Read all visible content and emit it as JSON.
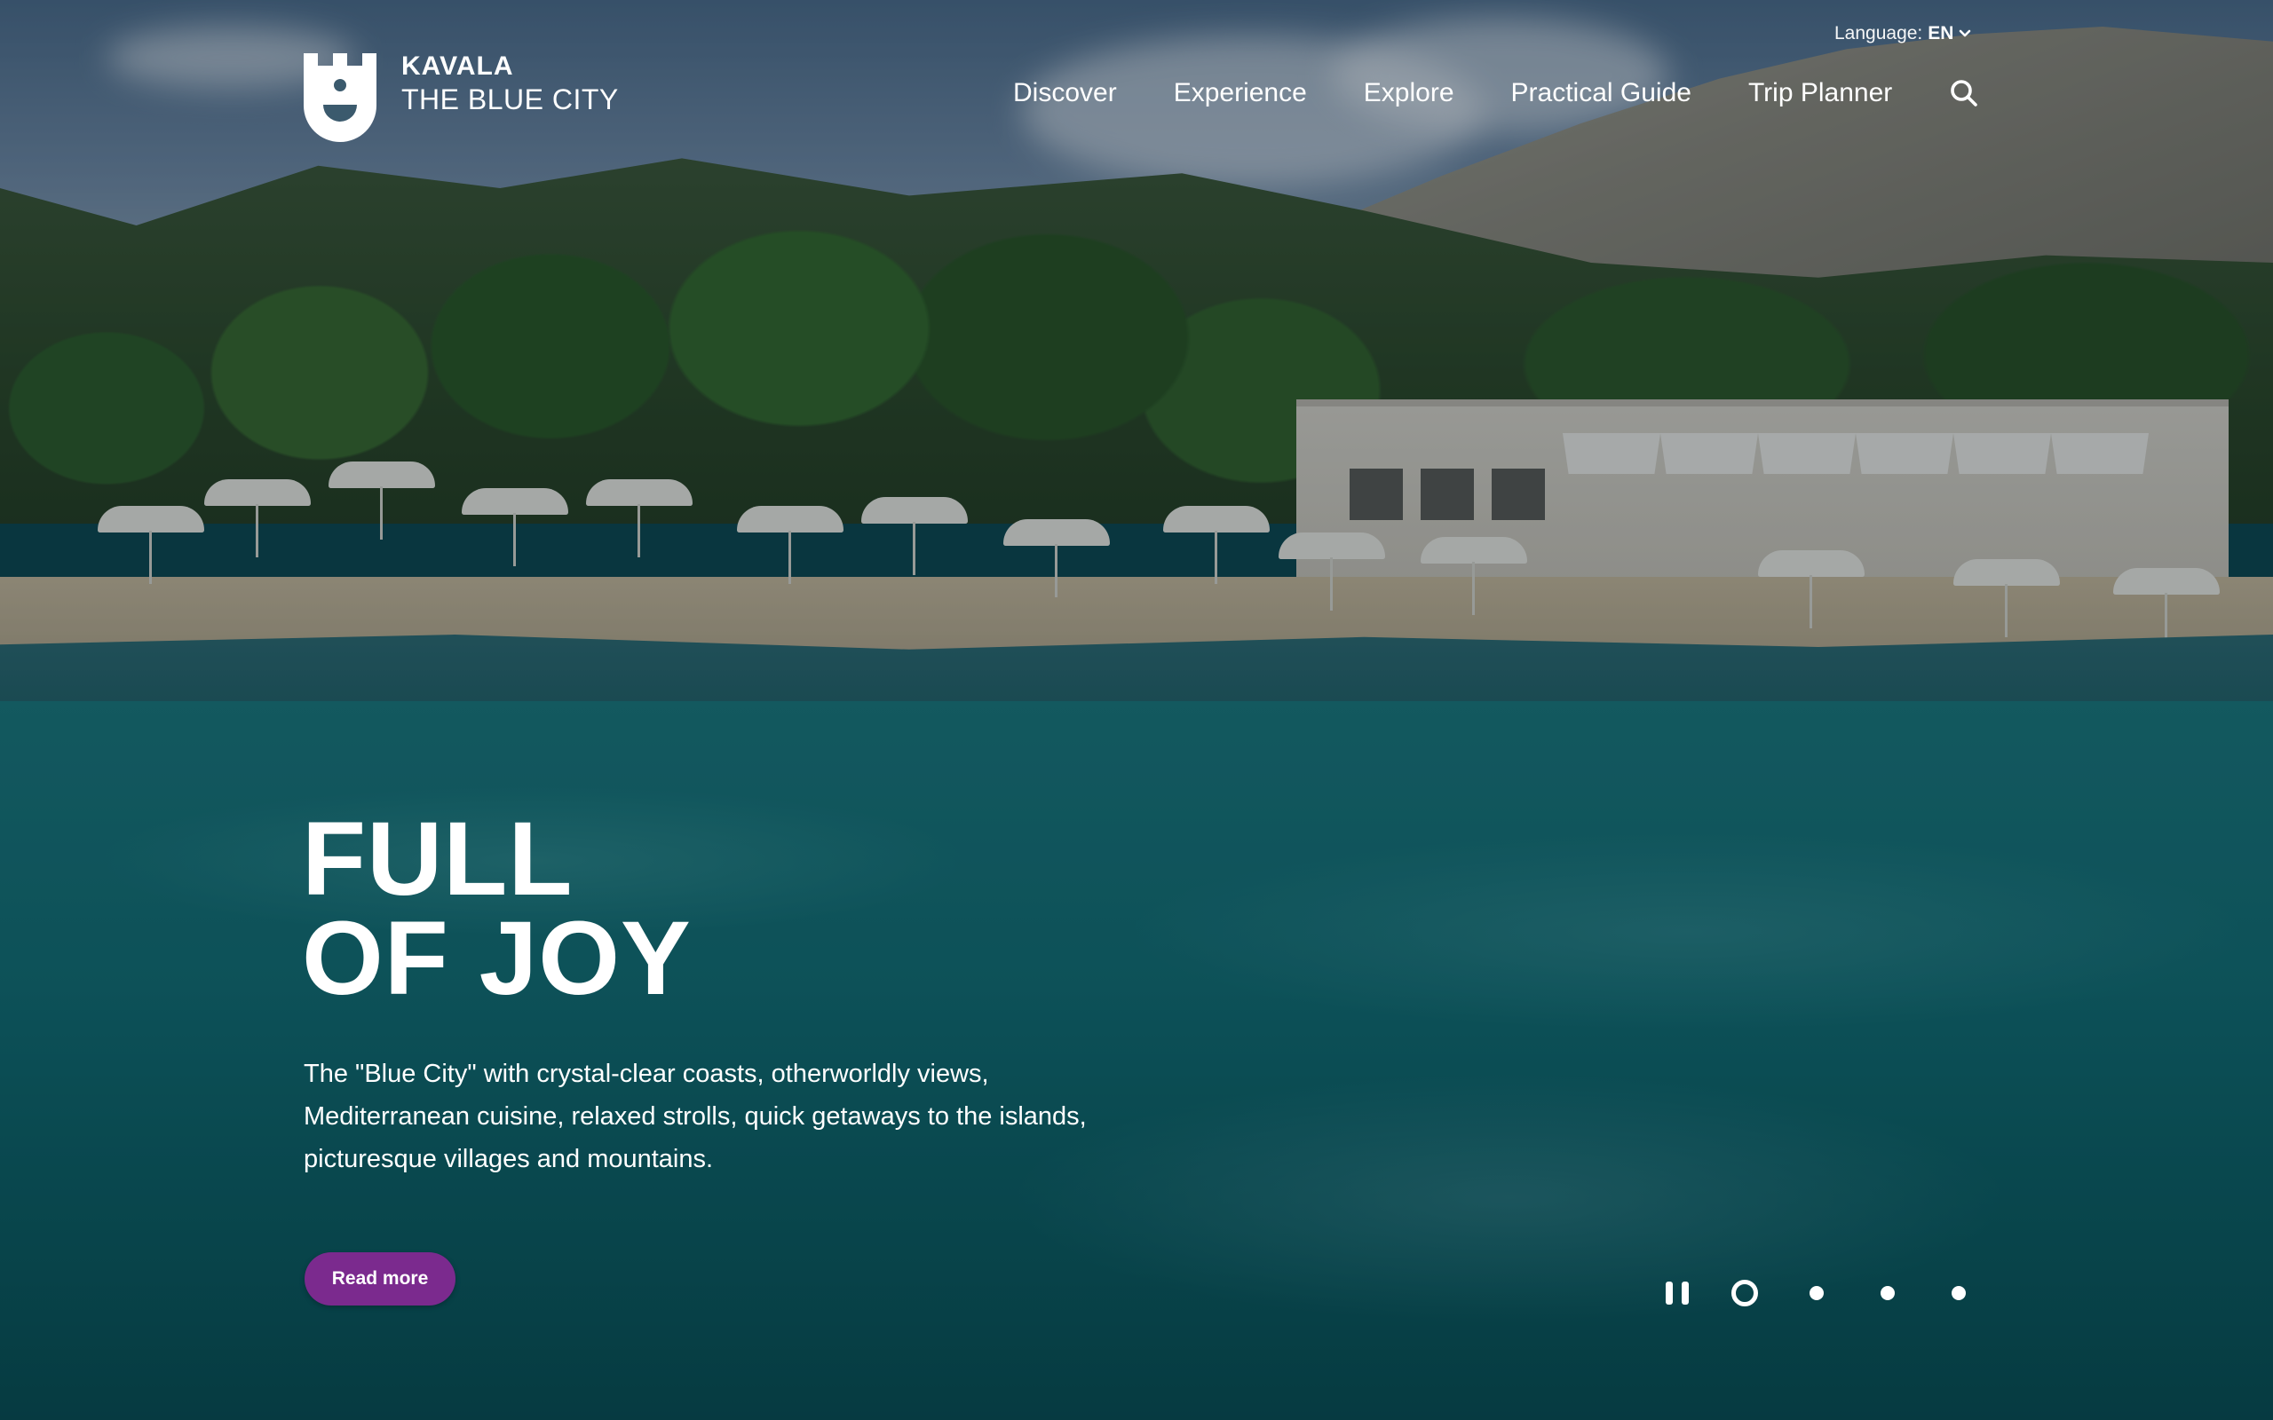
{
  "header": {
    "logo": {
      "title": "KAVALA",
      "subtitle": "THE BLUE CITY",
      "icon": "castle-tower-smile-icon"
    },
    "language": {
      "label": "Language:",
      "value": "EN",
      "icon": "chevron-down-icon"
    },
    "nav": {
      "items": [
        {
          "label": "Discover"
        },
        {
          "label": "Experience"
        },
        {
          "label": "Explore"
        },
        {
          "label": "Practical Guide"
        },
        {
          "label": "Trip Planner"
        }
      ],
      "search_icon": "search-icon"
    }
  },
  "hero": {
    "title_line1": "FULL",
    "title_line2": "OF JOY",
    "description": "The \"Blue City\" with crystal-clear coasts, otherworldly views, Mediterranean cuisine, relaxed strolls, quick getaways to the islands, picturesque villages and mountains.",
    "read_more_label": "Read more",
    "background": "beach with umbrellas, hillside and turquoise sea"
  },
  "slider": {
    "pause_icon": "pause-icon",
    "slide_count": 4,
    "active_slide": 1
  },
  "colors": {
    "accent": "#7b2a8e",
    "text": "#ffffff",
    "sea": "#137076"
  }
}
